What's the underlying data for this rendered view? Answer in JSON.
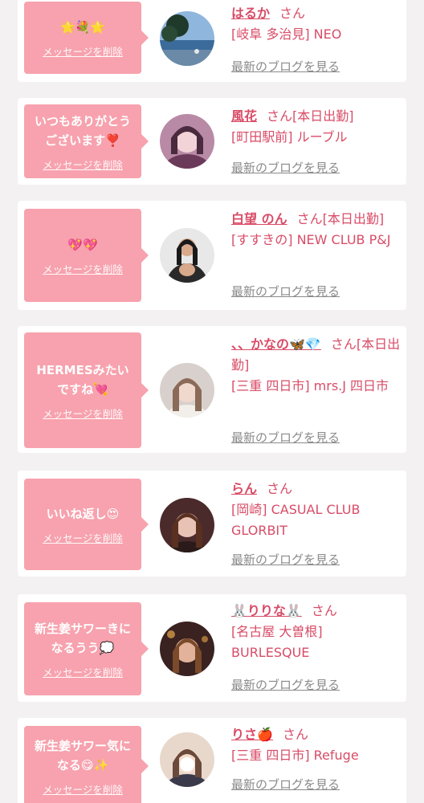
{
  "colors": {
    "bubble": "#f7a2ae",
    "accent": "#d84c67",
    "link_gray": "#8a8a8a",
    "background": "#f3f1f1"
  },
  "entries": [
    {
      "message": "🌟💐🌟",
      "delete_label": "メッセージを削除",
      "name": "はるか",
      "honorific": "さん",
      "status": "",
      "location": "[岐阜 多治見] NEO",
      "blog_label": "最新のブログを見る",
      "avatar_icon": "avatar-photo-landscape-icon"
    },
    {
      "message": "いつもありがとう\nございます❣️",
      "delete_label": "メッセージを削除",
      "name": "風花",
      "honorific": "さん",
      "status": "[本日出勤]",
      "location": "[町田駅前] ルーブル",
      "blog_label": "最新のブログを見る",
      "avatar_icon": "avatar-photo-woman-icon"
    },
    {
      "message": "💖💖",
      "delete_label": "メッセージを削除",
      "name": "白望 のん",
      "honorific": "さん",
      "status": "[本日出勤]",
      "location": "[すすきの] NEW CLUB P&J",
      "blog_label": "最新のブログを見る",
      "avatar_icon": "avatar-photo-woman-icon"
    },
    {
      "message": "HERMESみたい\nですね💘",
      "delete_label": "メッセージを削除",
      "name": "、、かなの🦋💎",
      "honorific": "さん",
      "status": "[本日出勤]",
      "location": "[三重 四日市] mrs.J 四日市",
      "blog_label": "最新のブログを見る",
      "avatar_icon": "avatar-photo-woman-icon"
    },
    {
      "message": "いいね返し😍",
      "delete_label": "メッセージを削除",
      "name": "らん",
      "honorific": "さん",
      "status": "",
      "location": "[岡崎] CASUAL CLUB GLORBIT",
      "blog_label": "最新のブログを見る",
      "avatar_icon": "avatar-photo-woman-icon"
    },
    {
      "message": "新生姜サワーきに\nなるうう💭",
      "delete_label": "メッセージを削除",
      "name": "🐰りりな🐰",
      "honorific": "さん",
      "status": "",
      "location": "[名古屋 大曽根] BURLESQUE",
      "blog_label": "最新のブログを見る",
      "avatar_icon": "avatar-photo-woman-icon"
    },
    {
      "message": "新生姜サワー気に\nなる😋✨",
      "delete_label": "メッセージを削除",
      "name": "りさ🍎",
      "honorific": "さん",
      "status": "",
      "location": "[三重 四日市] Refuge",
      "blog_label": "最新のブログを見る",
      "avatar_icon": "avatar-photo-woman-icon"
    }
  ]
}
